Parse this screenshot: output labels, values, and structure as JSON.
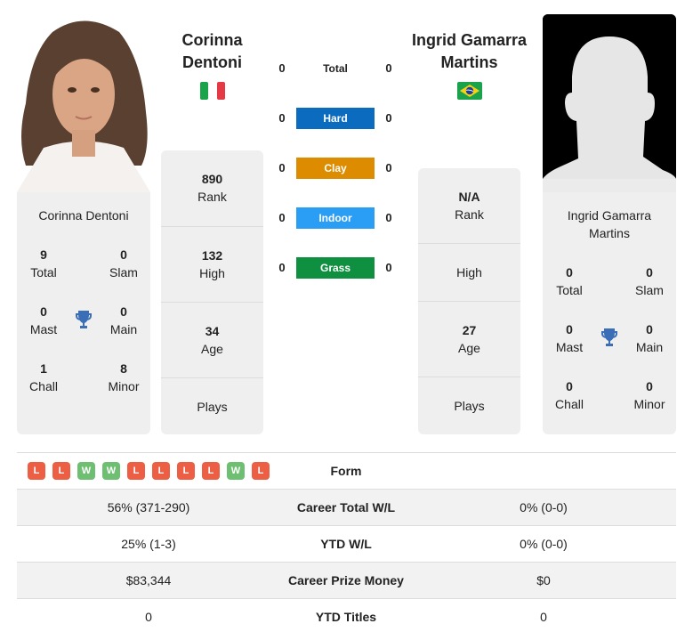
{
  "player1": {
    "name": "Corinna Dentoni",
    "name_line1": "Corinna",
    "name_line2": "Dentoni",
    "country_flag": "italy-flag",
    "card_name": "Corinna Dentoni",
    "titles": {
      "total": {
        "value": "9",
        "label": "Total"
      },
      "slam": {
        "value": "0",
        "label": "Slam"
      },
      "mast": {
        "value": "0",
        "label": "Mast"
      },
      "main": {
        "value": "0",
        "label": "Main"
      },
      "chall": {
        "value": "1",
        "label": "Chall"
      },
      "minor": {
        "value": "8",
        "label": "Minor"
      }
    },
    "rank": {
      "value": "890",
      "label": "Rank"
    },
    "high": {
      "value": "132",
      "label": "High"
    },
    "age": {
      "value": "34",
      "label": "Age"
    },
    "plays": {
      "value": "",
      "label": "Plays"
    }
  },
  "player2": {
    "name": "Ingrid Gamarra Martins",
    "name_line1": "Ingrid Gamarra",
    "name_line2": "Martins",
    "country_flag": "brazil-flag",
    "card_name_line1": "Ingrid Gamarra",
    "card_name_line2": "Martins",
    "titles": {
      "total": {
        "value": "0",
        "label": "Total"
      },
      "slam": {
        "value": "0",
        "label": "Slam"
      },
      "mast": {
        "value": "0",
        "label": "Mast"
      },
      "main": {
        "value": "0",
        "label": "Main"
      },
      "chall": {
        "value": "0",
        "label": "Chall"
      },
      "minor": {
        "value": "0",
        "label": "Minor"
      }
    },
    "rank": {
      "value": "N/A",
      "label": "Rank"
    },
    "high": {
      "value": "",
      "label": "High"
    },
    "age": {
      "value": "27",
      "label": "Age"
    },
    "plays": {
      "value": "",
      "label": "Plays"
    }
  },
  "surfaces": [
    {
      "label": "Total",
      "p1": "0",
      "p2": "0",
      "color": ""
    },
    {
      "label": "Hard",
      "p1": "0",
      "p2": "0",
      "color": "#0a6bbf"
    },
    {
      "label": "Clay",
      "p1": "0",
      "p2": "0",
      "color": "#dd8c00"
    },
    {
      "label": "Indoor",
      "p1": "0",
      "p2": "0",
      "color": "#2a9df4"
    },
    {
      "label": "Grass",
      "p1": "0",
      "p2": "0",
      "color": "#0e9040"
    }
  ],
  "form": {
    "label": "Form",
    "p1": [
      "L",
      "L",
      "W",
      "W",
      "L",
      "L",
      "L",
      "L",
      "W",
      "L"
    ]
  },
  "comparison": [
    {
      "label": "Career Total W/L",
      "p1": "56% (371-290)",
      "p2": "0% (0-0)"
    },
    {
      "label": "YTD W/L",
      "p1": "25% (1-3)",
      "p2": "0% (0-0)"
    },
    {
      "label": "Career Prize Money",
      "p1": "$83,344",
      "p2": "$0"
    },
    {
      "label": "YTD Titles",
      "p1": "0",
      "p2": "0"
    }
  ],
  "colors": {
    "trophy": "#3a6fb8",
    "loss": "#ec5f44",
    "win": "#6fbf73"
  }
}
